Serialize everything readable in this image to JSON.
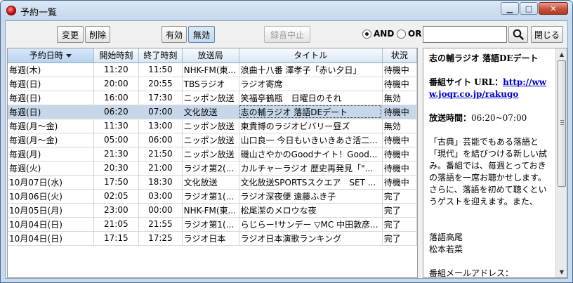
{
  "window": {
    "title": "予約一覧"
  },
  "toolbar": {
    "change_label": "変更",
    "delete_label": "削除",
    "enable_label": "有効",
    "disable_label": "無効",
    "stop_recording_label": "録音中止",
    "and_label": "AND",
    "or_label": "OR",
    "search_value": "",
    "close_label": "閉じる"
  },
  "table": {
    "columns": [
      "予約日時",
      "開始時刻",
      "終了時刻",
      "放送局",
      "タイトル",
      "状況"
    ],
    "rows": [
      [
        "毎週(木)",
        "11:20",
        "11:50",
        "NHK-FM(東...",
        "浪曲十八番 澤孝子「赤い夕日」",
        "待機中"
      ],
      [
        "毎週(日)",
        "20:00",
        "20:55",
        "TBSラジオ",
        "ラジオ寄席",
        "待機中"
      ],
      [
        "毎週(日)",
        "16:00",
        "17:30",
        "ニッポン放送",
        "笑福亭鶴瓶　日曜日のそれ",
        "無効"
      ],
      [
        "毎週(日)",
        "06:20",
        "07:00",
        "文化放送",
        "志の輔ラジオ 落語DEデート",
        "待機中"
      ],
      [
        "毎週(月〜金)",
        "11:30",
        "13:00",
        "ニッポン放送",
        "東貴博のラジオビバリー昼ズ",
        "無効"
      ],
      [
        "毎週(月〜金)",
        "05:00",
        "06:00",
        "ニッポン放送",
        "山口良一 今日もいきいきあさ活二...",
        "待機中"
      ],
      [
        "毎週(月)",
        "21:30",
        "21:50",
        "ニッポン放送",
        "磯山さやかのGoodナイト！Good...",
        "待機中"
      ],
      [
        "毎週(火)",
        "20:30",
        "21:00",
        "ラジオ第2(...",
        "カルチャーラジオ 歴史再発見「\"...",
        "待機中"
      ],
      [
        "10月07日(水)",
        "17:50",
        "18:30",
        "文化放送",
        "文化放送SPORTSスクエア　SET ...",
        "待機中"
      ],
      [
        "10月06日(火)",
        "02:05",
        "03:00",
        "ラジオ第1(...",
        "ラジオ深夜便 遠藤ふき子",
        "完了"
      ],
      [
        "10月05日(月)",
        "23:00",
        "00:00",
        "NHK-FM(東...",
        "松尾潔のメロウな夜",
        "完了"
      ],
      [
        "10月04日(日)",
        "21:05",
        "21:55",
        "ラジオ第1(...",
        "らじらー!サンデー ▽MC 中田敦彦...",
        "完了"
      ],
      [
        "10月04日(日)",
        "17:15",
        "17:25",
        "ラジオ日本",
        "ラジオ日本演歌ランキング",
        "完了"
      ]
    ]
  },
  "detail": {
    "title": "志の輔ラジオ 落語DEデート",
    "site_label": "番組サイト URL：",
    "site_url": "http://www.joqr.co.jp/rakugo",
    "time_label": "放送時間：",
    "time_value": "06:20~07:00",
    "description": "「古典」芸能でもある落語と「現代」を結びつける新しい試み。番組では、毎週とっておきの落語を一席お聴かせします。さらに、落語を初めて聴くというゲストを迎えます。また、",
    "performer_1": "落語高尾",
    "performer_2": "松本若菜",
    "mail_label": "番組メールアドレス："
  }
}
